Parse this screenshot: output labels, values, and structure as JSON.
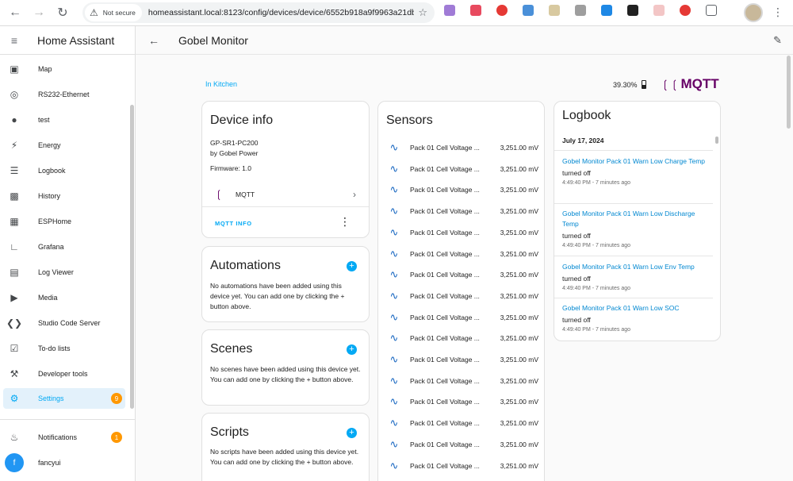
{
  "browser": {
    "not_secure_label": "Not secure",
    "url": "homeassistant.local:8123/config/devices/device/6552b918a9f9963a21db..."
  },
  "sidebar": {
    "title": "Home Assistant",
    "items": [
      {
        "label": "Map",
        "icon": "map-icon"
      },
      {
        "label": "RS232-Ethernet",
        "icon": "web-icon"
      },
      {
        "label": "test",
        "icon": "person-icon"
      },
      {
        "label": "Energy",
        "icon": "lightning-icon"
      },
      {
        "label": "Logbook",
        "icon": "list-icon"
      },
      {
        "label": "History",
        "icon": "chart-icon"
      },
      {
        "label": "ESPHome",
        "icon": "chip-icon"
      },
      {
        "label": "Grafana",
        "icon": "graph-icon"
      },
      {
        "label": "Log Viewer",
        "icon": "document-icon"
      },
      {
        "label": "Media",
        "icon": "play-icon"
      },
      {
        "label": "Studio Code Server",
        "icon": "code-icon"
      },
      {
        "label": "To-do lists",
        "icon": "clipboard-icon"
      },
      {
        "label": "Developer tools",
        "icon": "hammer-icon"
      },
      {
        "label": "Settings",
        "icon": "gear-icon",
        "badge": "9",
        "active": true
      }
    ],
    "notifications": {
      "label": "Notifications",
      "badge": "1"
    },
    "user": {
      "initial": "f",
      "name": "fancyui"
    }
  },
  "toolbar": {
    "title": "Gobel Monitor"
  },
  "device": {
    "area_link": "In Kitchen",
    "battery": "39.30%",
    "integration_logo": "MQTT"
  },
  "device_info": {
    "title": "Device info",
    "model": "GP-SR1-PC200",
    "manufacturer": "by Gobel Power",
    "firmware": "Firmware: 1.0",
    "integration": "MQTT",
    "action": "MQTT INFO"
  },
  "automations": {
    "title": "Automations",
    "text": "No automations have been added using this device yet. You can add one by clicking the + button above."
  },
  "scenes": {
    "title": "Scenes",
    "text": "No scenes have been added using this device yet. You can add one by clicking the + button above."
  },
  "scripts": {
    "title": "Scripts",
    "text": "No scripts have been added using this device yet. You can add one by clicking the + button above."
  },
  "sensors": {
    "title": "Sensors",
    "rows": [
      {
        "name": "Pack 01 Cell Voltage ...",
        "value": "3,251.00 mV"
      },
      {
        "name": "Pack 01 Cell Voltage ...",
        "value": "3,251.00 mV"
      },
      {
        "name": "Pack 01 Cell Voltage ...",
        "value": "3,251.00 mV"
      },
      {
        "name": "Pack 01 Cell Voltage ...",
        "value": "3,251.00 mV"
      },
      {
        "name": "Pack 01 Cell Voltage ...",
        "value": "3,251.00 mV"
      },
      {
        "name": "Pack 01 Cell Voltage ...",
        "value": "3,251.00 mV"
      },
      {
        "name": "Pack 01 Cell Voltage ...",
        "value": "3,251.00 mV"
      },
      {
        "name": "Pack 01 Cell Voltage ...",
        "value": "3,251.00 mV"
      },
      {
        "name": "Pack 01 Cell Voltage ...",
        "value": "3,251.00 mV"
      },
      {
        "name": "Pack 01 Cell Voltage ...",
        "value": "3,251.00 mV"
      },
      {
        "name": "Pack 01 Cell Voltage ...",
        "value": "3,251.00 mV"
      },
      {
        "name": "Pack 01 Cell Voltage ...",
        "value": "3,251.00 mV"
      },
      {
        "name": "Pack 01 Cell Voltage ...",
        "value": "3,251.00 mV"
      },
      {
        "name": "Pack 01 Cell Voltage ...",
        "value": "3,251.00 mV"
      },
      {
        "name": "Pack 01 Cell Voltage ...",
        "value": "3,251.00 mV"
      },
      {
        "name": "Pack 01 Cell Voltage ...",
        "value": "3,251.00 mV"
      }
    ]
  },
  "logbook": {
    "title": "Logbook",
    "date": "July 17, 2024",
    "entries": [
      {
        "link": "Gobel Monitor Pack 01 Warn Low Charge Temp",
        "state": "turned off",
        "time": "4:49:40 PM - 7 minutes ago"
      },
      {
        "link": "Gobel Monitor Pack 01 Warn Low Discharge Temp",
        "state": "turned off",
        "time": "4:49:40 PM - 7 minutes ago"
      },
      {
        "link": "Gobel Monitor Pack 01 Warn Low Env Temp",
        "state": "turned off",
        "time": "4:49:40 PM - 7 minutes ago"
      },
      {
        "link": "Gobel Monitor Pack 01 Warn Low SOC",
        "state": "turned off",
        "time": "4:49:40 PM - 7 minutes ago"
      }
    ]
  },
  "colors": {
    "accent": "#03a9f4",
    "badge": "#ff9800",
    "mqtt": "#660066"
  }
}
